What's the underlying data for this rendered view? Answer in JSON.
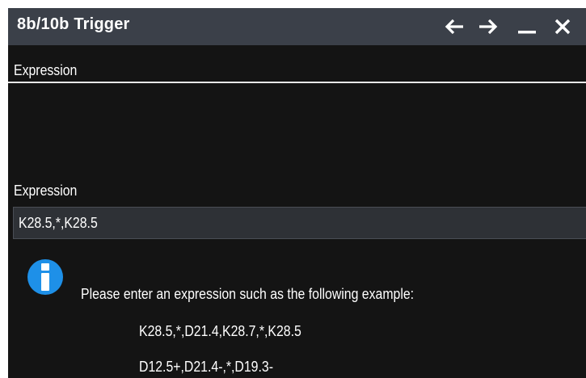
{
  "window": {
    "title": "8b/10b Trigger",
    "buttons": {
      "back_icon": "arrow-left-icon",
      "forward_icon": "arrow-right-icon",
      "minimize_icon": "minimize-icon",
      "close_icon": "close-icon"
    }
  },
  "tabs": [
    {
      "label": "Expression",
      "selected": true
    }
  ],
  "form": {
    "expression_label": "Expression",
    "expression_value": "K28.5,*,K28.5"
  },
  "info": {
    "icon": "info-icon",
    "message": "Please enter an expression such as the following example:",
    "examples": [
      "K28.5,*,D21.4,K28.7,*,K28.5",
      "D12.5+,D21.4-,*,D19.3-"
    ]
  },
  "colors": {
    "titlebar": "#3b4049",
    "background": "#141414",
    "input_background": "#2e3136",
    "info_icon": "#1e90e8",
    "text": "#ffffff"
  }
}
